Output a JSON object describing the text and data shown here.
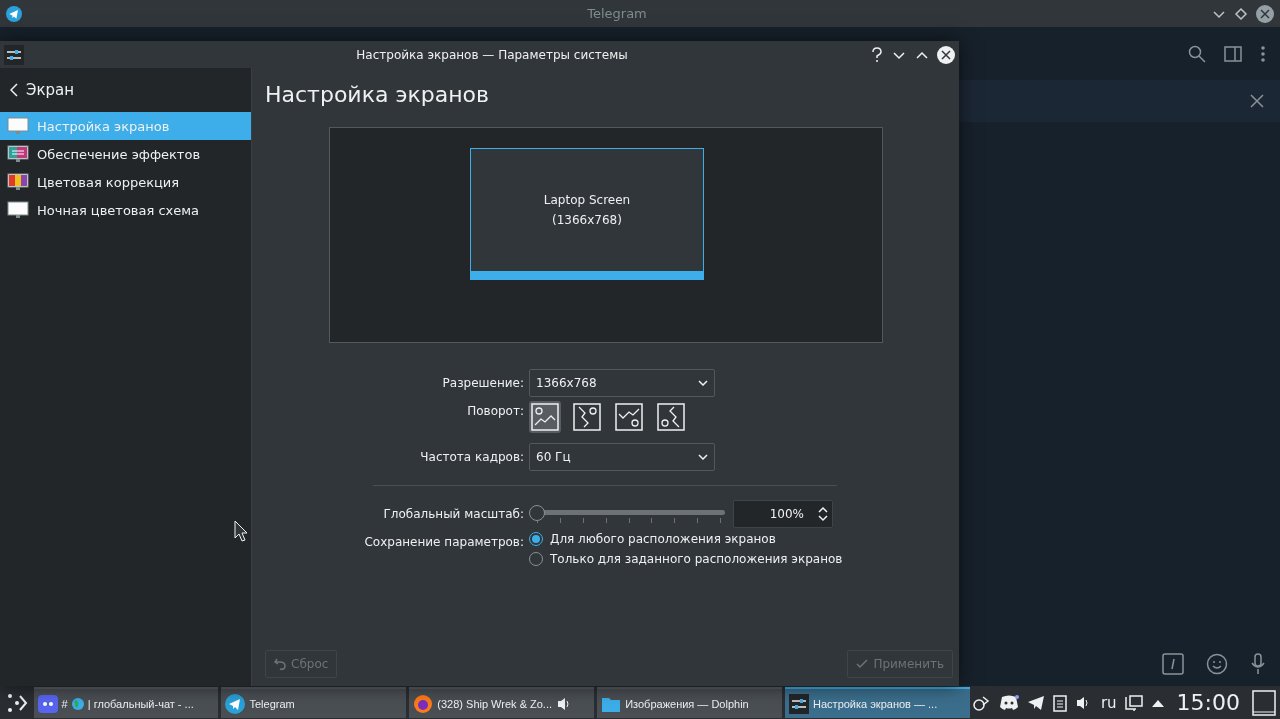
{
  "telegram": {
    "title": "Telegram"
  },
  "dialog": {
    "title": "Настройка экранов — Параметры системы",
    "sidebar": {
      "back": "Экран",
      "items": [
        {
          "label": "Настройка экранов",
          "selected": true
        },
        {
          "label": "Обеспечение эффектов",
          "selected": false
        },
        {
          "label": "Цветовая коррекция",
          "selected": false
        },
        {
          "label": "Ночная цветовая схема",
          "selected": false
        }
      ]
    },
    "heading": "Настройка экранов",
    "preview": {
      "name": "Laptop Screen",
      "resolution": "(1366x768)"
    },
    "resolution": {
      "label": "Разрешение:",
      "value": "1366x768"
    },
    "rotation": {
      "label": "Поворот:",
      "options": [
        {
          "selected": true
        },
        {
          "selected": false
        },
        {
          "selected": false
        },
        {
          "selected": false
        }
      ]
    },
    "refresh": {
      "label": "Частота кадров:",
      "value": "60 Гц"
    },
    "scale": {
      "label": "Глобальный масштаб:",
      "level": 0,
      "value": "100%"
    },
    "save": {
      "label": "Сохранение параметров:",
      "options": [
        {
          "label": "Для любого расположения экранов",
          "selected": true
        },
        {
          "label": "Только для заданного расположения экранов",
          "selected": false
        }
      ]
    },
    "buttons": [
      {
        "label": "Сброс",
        "kind": "reset",
        "disabled": true
      },
      {
        "label": "Применить",
        "kind": "apply",
        "disabled": true
      }
    ]
  },
  "taskbar": {
    "tasks": [
      {
        "label": "#",
        "label2": "| глобальный-чат - ...",
        "selected": false,
        "audio": false
      },
      {
        "label": "Telegram",
        "selected": false,
        "audio": false
      },
      {
        "label": "(328) Ship Wrek & Zo...",
        "selected": false,
        "audio": true
      },
      {
        "label": "Изображения — Dolphin",
        "selected": false,
        "audio": false
      },
      {
        "label": "Настройка экранов  — ...",
        "selected": true,
        "audio": false
      }
    ],
    "language": "ru",
    "clock": "15:00"
  }
}
